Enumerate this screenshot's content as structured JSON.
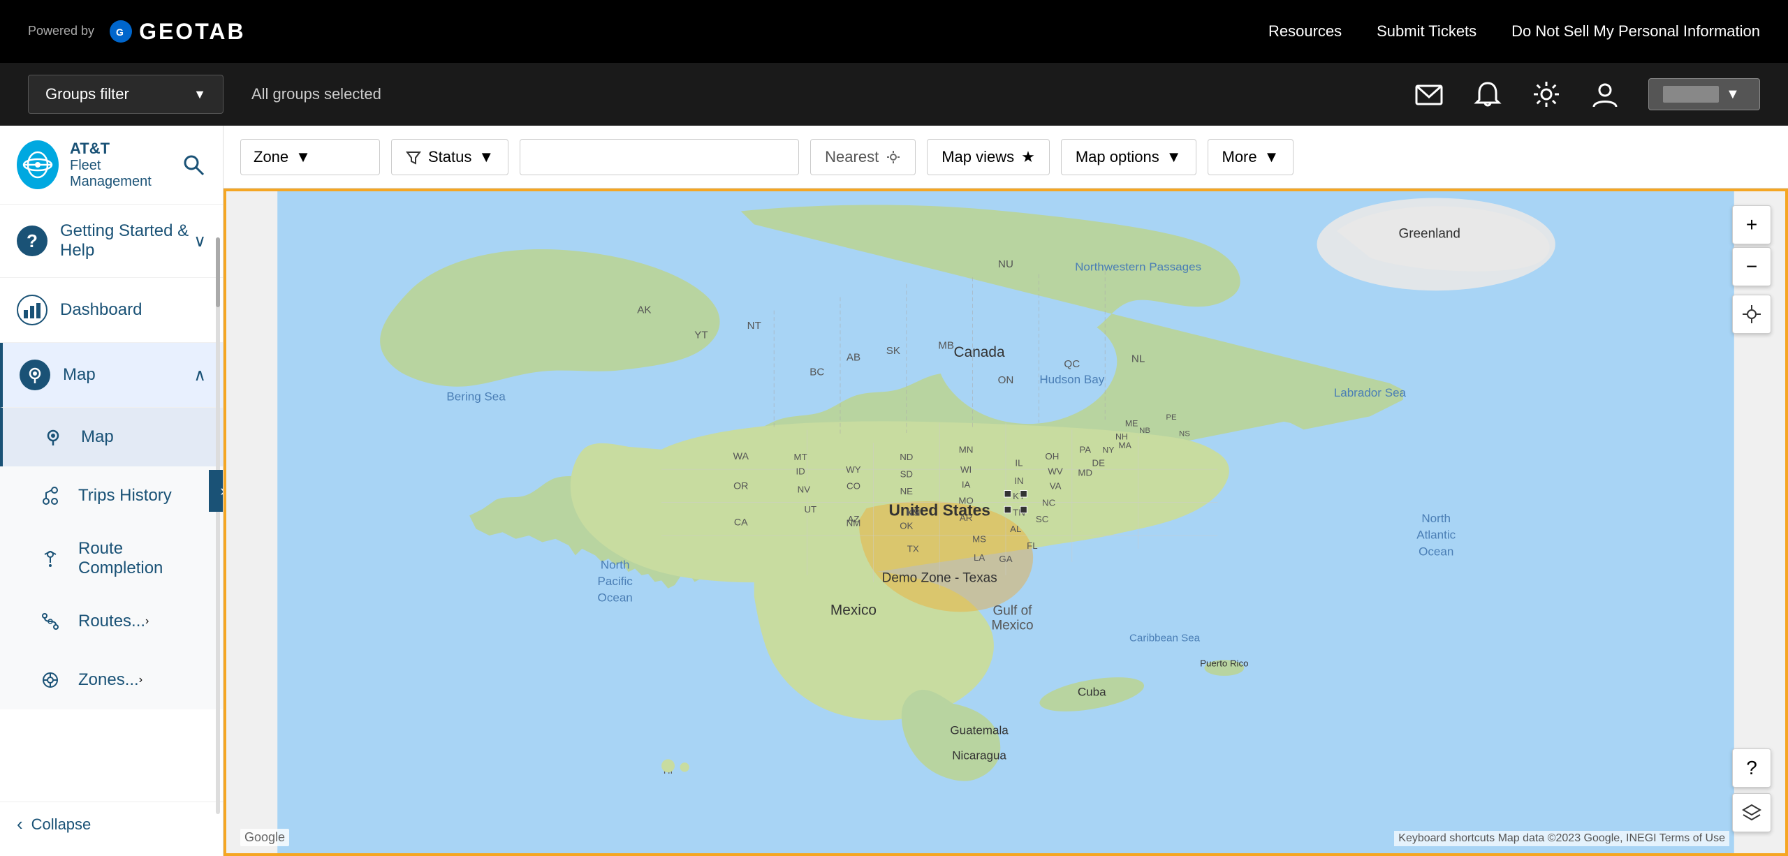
{
  "app": {
    "powered_by": "Powered by",
    "logo_text": "GEOTAB",
    "top_nav": {
      "resources": "Resources",
      "submit_tickets": "Submit Tickets",
      "do_not_sell": "Do Not Sell My Personal Information"
    }
  },
  "groups_bar": {
    "groups_filter_label": "Groups filter",
    "all_groups_text": "All groups selected",
    "icons": {
      "mail": "✉",
      "bell": "🔔",
      "settings": "⚙",
      "user": "👤",
      "dropdown": "▼"
    }
  },
  "sidebar": {
    "company": "AT&T",
    "product": "Fleet Management",
    "logo_abbr": "AT&T",
    "nav_items": [
      {
        "id": "getting-started",
        "label": "Getting Started & Help",
        "icon": "?",
        "has_chevron": true,
        "chevron": "∨"
      },
      {
        "id": "dashboard",
        "label": "Dashboard",
        "icon": "📊",
        "has_chevron": false
      },
      {
        "id": "map",
        "label": "Map",
        "icon": "🗺",
        "has_chevron": true,
        "chevron": "∧",
        "active": true
      }
    ],
    "map_sub_items": [
      {
        "id": "map-sub",
        "label": "Map",
        "icon": "🗺",
        "active": true
      },
      {
        "id": "trips-history",
        "label": "Trips History",
        "icon": "🚗"
      },
      {
        "id": "route-completion",
        "label": "Route Completion",
        "icon": "📍"
      },
      {
        "id": "routes",
        "label": "Routes...",
        "icon": "🛣",
        "has_arrow": true,
        "arrow": "›"
      },
      {
        "id": "zones",
        "label": "Zones...",
        "icon": "⚙",
        "has_arrow": true,
        "arrow": "›"
      }
    ],
    "collapse_label": "Collapse",
    "collapse_icon": "‹",
    "toggle_icon": "›"
  },
  "toolbar": {
    "zone_label": "Zone",
    "zone_arrow": "▼",
    "status_icon": "⚗",
    "status_label": "Status",
    "status_arrow": "▼",
    "search_placeholder": "",
    "nearest_label": "Nearest",
    "nearest_icon": "📍",
    "map_views_label": "Map views",
    "map_views_icon": "★",
    "map_options_label": "Map options",
    "map_options_arrow": "▼",
    "more_label": "More",
    "more_arrow": "▼"
  },
  "map": {
    "zone_label": "Demo Zone - Texas",
    "region_labels": {
      "greenland": "Greenland",
      "canada": "Canada",
      "united_states": "United States",
      "mexico": "Mexico",
      "bering_sea": "Bering Sea",
      "north_pacific": "North Pacific Ocean",
      "hudson_bay": "Hudson Bay",
      "labrador_sea": "Labrador Sea",
      "north_atlantic": "North Atlantic Ocean",
      "gulf_of_mexico": "Gulf of Mexico",
      "cuba": "Cuba",
      "puerto_rico": "Puerto Rico",
      "guatemala": "Guatemala",
      "nicaragua": "Nicaragua",
      "northwestern": "Northwestern Passages",
      "caribbean": "Caribbean Sea"
    },
    "google_label": "Google",
    "data_label": "Keyboard shortcuts   Map data ©2023 Google, INEGI   Terms of Use",
    "controls": {
      "zoom_in": "+",
      "zoom_out": "−",
      "locate": "⊕",
      "help": "?",
      "layers": "⊞"
    }
  }
}
